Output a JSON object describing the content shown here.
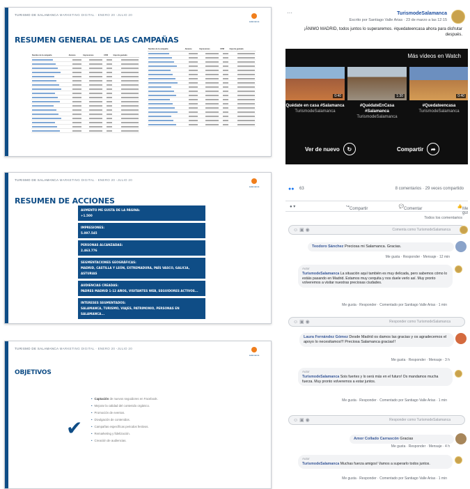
{
  "slide1": {
    "header": "TURISMO DE SALAMANCA",
    "header_sub": "MARKETING DIGITAL · ENERO 20 -JULIO 20",
    "title": "RESUMEN GENERAL DE LAS CAMPAÑAS",
    "table_left_header": [
      "Nombre de la campaña",
      "Alcance",
      "Impresiones",
      "CPM",
      "Importe gastado"
    ],
    "table_right_header": [
      "Nombre de la campaña",
      "Alcance",
      "Impresiones",
      "CPM",
      "Importe gastado"
    ]
  },
  "slide2": {
    "header": "TURISMO DE SALAMANCA",
    "header_sub": "MARKETING DIGITAL · ENERO 20 -JULIO 20",
    "title": "RESUMEN DE ACCIONES",
    "actions": [
      {
        "label": "AUMENTO ME GUSTA DE LA PÁGINA:",
        "value": "+1.500"
      },
      {
        "label": "IMPRESIONES:",
        "value": "5.097.545"
      },
      {
        "label": "PERSONAS ALCANZADAS:",
        "value": "2.463.776"
      },
      {
        "label": "SEGMENTACIONES GEOGRÁFICAS:",
        "value": "MADRID, CASTILLA Y LEÓN, EXTREMADURA, PAÍS VASCO, GALICIA, ASTURIAS"
      },
      {
        "label": "AUDIENCIAS CREADAS:",
        "value": "PADRES MADRID 1-12 AÑOS, VISITANTES WEB, SEGUIDORES ACTIVOS..."
      },
      {
        "label": "INTERESES SEGMENTADOS:",
        "value": "SALAMANCA, TURISMO, VIAJES, PATRIMONIO, PERSONAS EN SALAMANCA..."
      }
    ]
  },
  "slide3": {
    "header": "TURISMO DE SALAMANCA",
    "header_sub": "MARKETING DIGITAL · ENERO 20 -JULIO 20",
    "title": "OBJETIVOS",
    "objectives": [
      {
        "bold": "Captación",
        "rest": " de nuevos seguidores en Facebook."
      },
      {
        "bold": "",
        "rest": "Mejorar la calidad del contenido orgánico."
      },
      {
        "bold": "",
        "rest": "Promoción de eventos."
      },
      {
        "bold": "",
        "rest": "Divulgación de contenidos."
      },
      {
        "bold": "",
        "rest": "Campañas específicas periodos festivos."
      },
      {
        "bold": "",
        "rest": "Remarketing y fidelización."
      },
      {
        "bold": "",
        "rest": "Creación de audiencias."
      }
    ]
  },
  "facebook": {
    "page_name": "TurismodeSalamanca",
    "post_meta": "Escrito por Santiago Valle Arias · 23 de marzo a las 12:15",
    "post_text": "¡ÁNIMO MADRID, todos juntos lo superaremos. #quedateencasa ahora para disfrutar después.",
    "more_videos": "Más vídeos en Watch",
    "videos": [
      {
        "title": "#Quedateencasa",
        "channel": "TurismodeSalamanca",
        "duration": "0:40"
      },
      {
        "title": "#QuédateEnCasa #Salamanca",
        "channel": "TurismodeSalamanca",
        "duration": "1:30"
      },
      {
        "title": "Quédate en casa #Salamanca",
        "channel": "TurismodeSalamanca",
        "duration": "0:40"
      }
    ],
    "share_label": "Compartir",
    "replay_label": "Ver de nuevo",
    "reactions_count": "63",
    "comments_shares": "8 comentarios · 29 veces compartido",
    "like_label": "Me gusta",
    "comment_label": "Comentar",
    "share_action": "Compartir",
    "all_comments": "Todos los comentarios",
    "comment_placeholder": "Comenta como TurismodeSalamanca",
    "reply_placeholder": "Responder como TurismodeSalamanca",
    "comments": [
      {
        "author": "Teodoro Sánchez",
        "text": "Preciosa mi Salamanca. Gracias.",
        "links": "Me gusta · Responder · Mensaje · 12 min",
        "reply_author": "TurismodeSalamanca",
        "reply_tag": "Autor",
        "reply_text": "La situación aquí también es muy delicada, pero sabemos cómo lo estáis pasando en Madrid. Estamos muy cerquita y nos duele verlo así. Muy pronto volveremos a visitar nuestras preciosas ciudades.",
        "reply_links": "Me gusta · Responder · Comentado por Santiago Valle Arias · 1 min"
      },
      {
        "author": "Laura Fernández Gómez",
        "text": "Desde Madrid os damos las gracias y os agradecemos el apoyo lo necesitamos!!! Preciosa Salamanca gracias!!",
        "links": "Me gusta · Responder · Mensaje · 3 h",
        "reply_author": "TurismodeSalamanca",
        "reply_tag": "Autor",
        "reply_text": "Sois fuertes y lo será más en el futuro! Os mandamos mucha fuerza. Muy pronto volveremos a estar juntos.",
        "reply_links": "Me gusta · Responder · Comentado por Santiago Valle Arias · 1 min"
      },
      {
        "author": "Amor Collado Carrascón",
        "text": "Gracias",
        "links": "Me gusta · Responder · Mensaje · 4 h",
        "reply_author": "TurismodeSalamanca",
        "reply_tag": "Autor",
        "reply_text": "Muchas fuerza amigos! Vamos a superarlo todos juntos.",
        "reply_links": "Me gusta · Responder · Comentado por Santiago Valle Arias · 1 min"
      }
    ]
  }
}
